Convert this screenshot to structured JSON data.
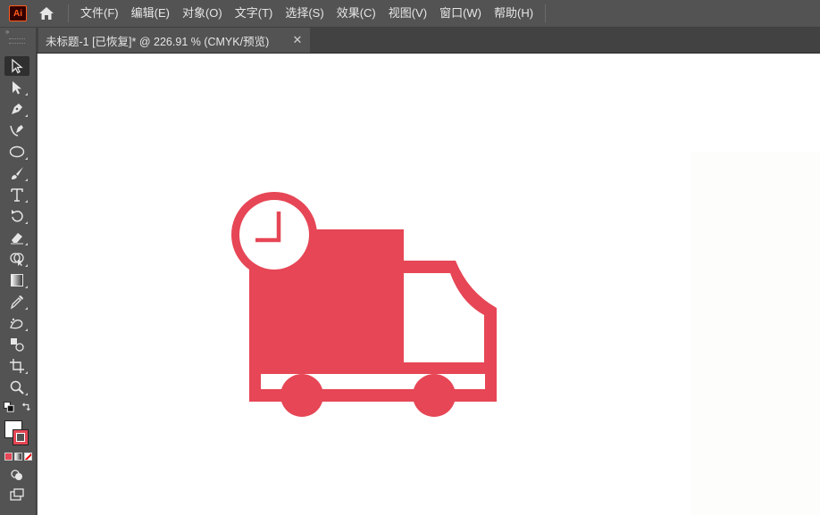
{
  "app": {
    "logo_text": "Ai",
    "accent": "#ff5c1a"
  },
  "menubar": {
    "home_icon": "home-icon",
    "items": [
      {
        "label": "文件(F)"
      },
      {
        "label": "编辑(E)"
      },
      {
        "label": "对象(O)"
      },
      {
        "label": "文字(T)"
      },
      {
        "label": "选择(S)"
      },
      {
        "label": "效果(C)"
      },
      {
        "label": "视图(V)"
      },
      {
        "label": "窗口(W)"
      },
      {
        "label": "帮助(H)"
      }
    ]
  },
  "tabs": {
    "active": {
      "label": "未标题-1 [已恢复]* @ 226.91 % (CMYK/预览)",
      "close": "✕"
    }
  },
  "toolbar": {
    "collapse_label": "››",
    "tools": [
      "selection-tool-icon",
      "direct-selection-tool-icon",
      "pen-tool-icon",
      "curvature-tool-icon",
      "ellipse-tool-icon",
      "paintbrush-tool-icon",
      "type-tool-icon",
      "rotate-tool-icon",
      "eraser-tool-icon",
      "shape-builder-tool-icon",
      "gradient-tool-icon",
      "eyedropper-tool-icon",
      "symbol-sprayer-tool-icon",
      "blend-tool-icon",
      "artboard-tool-icon",
      "zoom-tool-icon"
    ]
  },
  "artwork": {
    "icon": "delivery-truck-clock-icon",
    "fill": "#e64655"
  },
  "colors": {
    "ui_bg": "#535353",
    "canvas": "#ffffff",
    "tab_bar": "#424242"
  }
}
